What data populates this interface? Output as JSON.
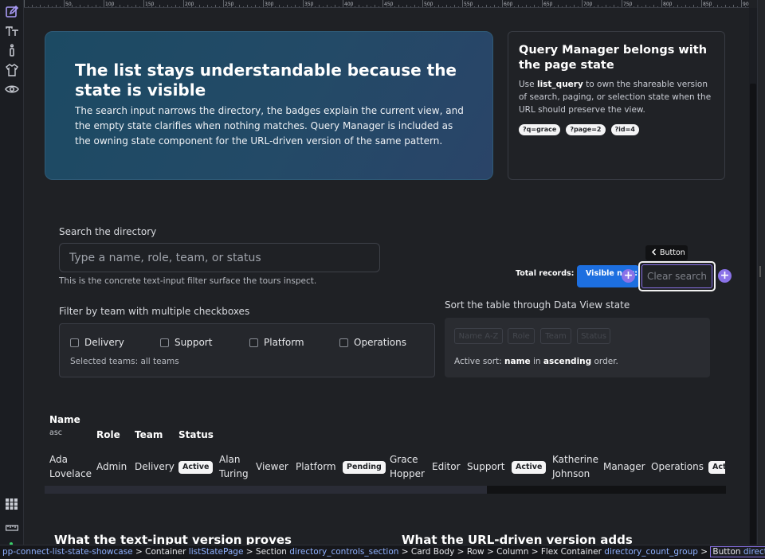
{
  "hero": {
    "title": "The list stays understandable because the state is visible",
    "body": "The search input narrows the directory, the badges explain the current view, and the empty state clarifies when nothing matches. Query Manager is included as the owning state component for the URL-driven version of the same pattern."
  },
  "side_card": {
    "title": "Query Manager belongs with the page state",
    "body_prefix": "Use ",
    "body_code": "list_query",
    "body_suffix": " to own the shareable version of search, paging, or selection state when the URL should preserve the view.",
    "chips": [
      "?q=grace",
      "?page=2",
      "?id=4"
    ]
  },
  "search": {
    "label": "Search the directory",
    "placeholder": "Type a name, role, team, or status",
    "value": "",
    "hint": "This is the concrete text-input filter surface the tours inspect."
  },
  "counts": {
    "total_label": "Total records:",
    "visible_label": "Visible now:",
    "clear_label": "Clear search",
    "tooltip": "Button",
    "add_glyph": "+"
  },
  "team_filter": {
    "label": "Filter by team with multiple checkboxes",
    "options": [
      "Delivery",
      "Support",
      "Platform",
      "Operations"
    ],
    "note": "Selected teams: all teams"
  },
  "sort": {
    "label": "Sort the table through Data View state",
    "buttons": [
      "Name A-Z",
      "Role",
      "Team",
      "Status"
    ],
    "note_prefix": "Active sort: ",
    "note_field": "name",
    "note_mid": " in ",
    "note_dir": "ascending",
    "note_suffix": " order."
  },
  "table": {
    "headers": {
      "name": "Name",
      "name_sub": "asc",
      "role": "Role",
      "team": "Team",
      "status": "Status"
    },
    "rows": [
      {
        "name_line1": "Ada",
        "name_line2": "Lovelace",
        "role": "Admin",
        "team": "Delivery",
        "status": "Active"
      },
      {
        "name_line1": "Alan",
        "name_line2": "Turing",
        "role": "Viewer",
        "team": "Platform",
        "status": "Pending"
      },
      {
        "name_line1": "Grace",
        "name_line2": "Hopper",
        "role": "Editor",
        "team": "Support",
        "status": "Active"
      },
      {
        "name_line1": "Katherine",
        "name_line2": "Johnson",
        "role": "Manager",
        "team": "Operations",
        "status": "Active"
      }
    ]
  },
  "sections": {
    "left": "What the text-input version proves",
    "right": "What the URL-driven version adds"
  },
  "breadcrumb": {
    "app": "pp-connect-list-state-showcase",
    "items": [
      {
        "kind": "Container",
        "id": "listStatePage"
      },
      {
        "kind": "Section",
        "id": "directory_controls_section"
      },
      {
        "kind": "Card Body",
        "id": ""
      },
      {
        "kind": "Row",
        "id": ""
      },
      {
        "kind": "Column",
        "id": ""
      },
      {
        "kind": "Flex Container",
        "id": "directory_count_group"
      },
      {
        "kind": "Button",
        "id": "directory_clear_button"
      }
    ],
    "sep": " > "
  },
  "ruler_labels": [
    "50",
    "100",
    "150",
    "200",
    "250",
    "300",
    "350",
    "400",
    "450",
    "500",
    "550",
    "600",
    "650",
    "700",
    "750",
    "800",
    "850",
    "900"
  ],
  "colors": {
    "accent": "#8a72e8",
    "primary_button": "#1d6fe0",
    "hero_start": "#1c4a63",
    "hero_end": "#2a4468"
  }
}
